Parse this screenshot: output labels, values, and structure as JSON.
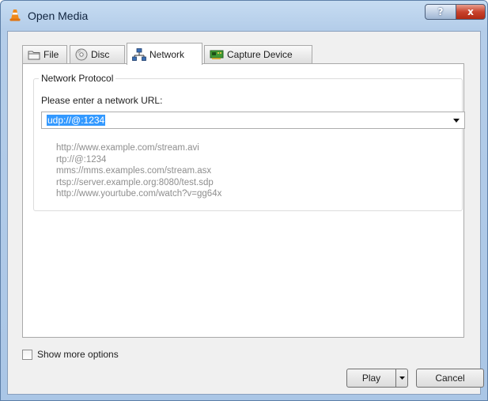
{
  "window": {
    "title": "Open Media",
    "controls": {
      "help": "?",
      "close": "x"
    }
  },
  "tabs": [
    {
      "label": "File",
      "icon": "folder-icon"
    },
    {
      "label": "Disc",
      "icon": "disc-icon"
    },
    {
      "label": "Network",
      "icon": "network-icon",
      "active": true
    },
    {
      "label": "Capture Device",
      "icon": "capture-card-icon"
    }
  ],
  "network": {
    "group_title": "Network Protocol",
    "url_label": "Please enter a network URL:",
    "url_value": "udp://@:1234",
    "examples": [
      "http://www.example.com/stream.avi",
      "rtp://@:1234",
      "mms://mms.examples.com/stream.asx",
      "rtsp://server.example.org:8080/test.sdp",
      "http://www.yourtube.com/watch?v=gg64x"
    ]
  },
  "options": {
    "show_more_label": "Show more options",
    "checked": false
  },
  "buttons": {
    "play": "Play",
    "cancel": "Cancel"
  },
  "colors": {
    "selection": "#3399ff",
    "example_text": "#8e8e8e",
    "close_red": "#c8432d"
  }
}
